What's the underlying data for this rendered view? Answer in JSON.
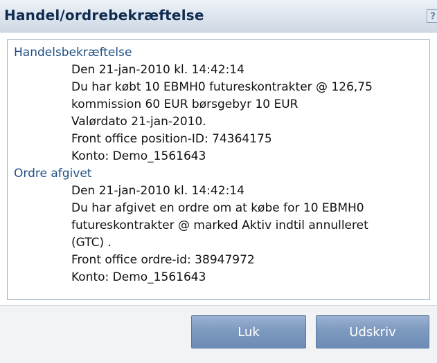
{
  "dialog": {
    "title": "Handel/ordrebekræftelse",
    "help_icon_glyph": "?"
  },
  "trade_confirmation": {
    "heading": "Handelsbekræftelse",
    "lines": [
      "Den 21-jan-2010 kl. 14:42:14",
      "Du har købt 10 EBMH0 futureskontrakter @ 126,75",
      "kommission 60 EUR børsgebyr 10 EUR",
      "Valørdato 21-jan-2010.",
      "Front office position-ID: 74364175",
      "Konto: Demo_1561643"
    ]
  },
  "order_placed": {
    "heading": "Ordre afgivet",
    "lines": [
      "Den 21-jan-2010 kl. 14:42:14",
      "Du har afgivet en ordre om at købe for 10 EBMH0",
      "futureskontrakter @ marked Aktiv indtil annulleret",
      "(GTC) .",
      "Front office ordre-id: 38947972",
      "Konto: Demo_1561643"
    ]
  },
  "buttons": {
    "close_label": "Luk",
    "print_label": "Udskriv"
  },
  "colors": {
    "title_text": "#0f2b4f",
    "heading_text": "#1f4f86",
    "button_fill": "#7d99bf"
  }
}
